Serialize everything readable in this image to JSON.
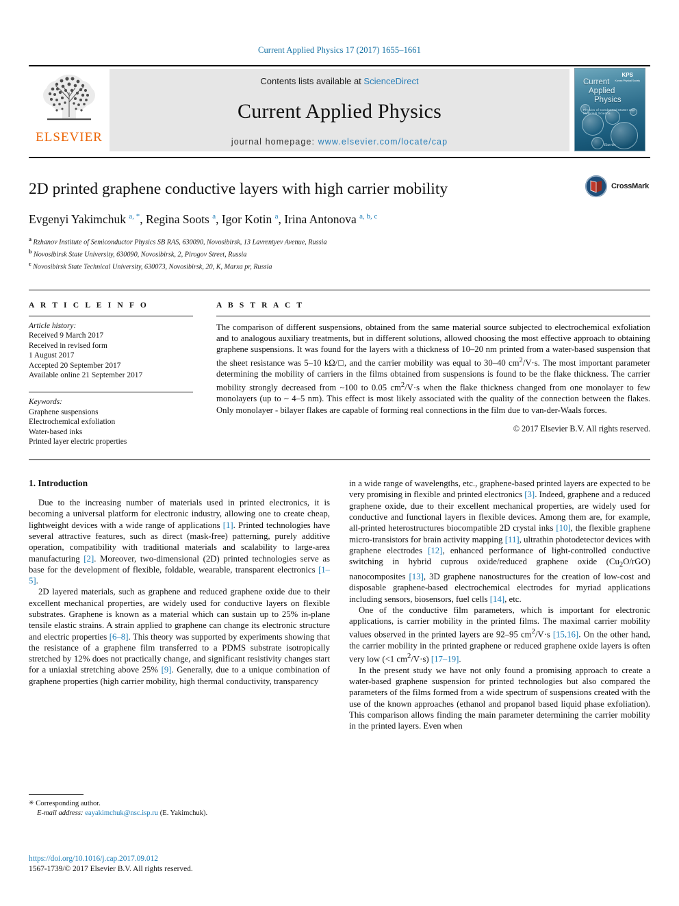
{
  "running_head": "Current Applied Physics 17 (2017) 1655–1661",
  "banner": {
    "publisher_name": "ELSEVIER",
    "contents_prefix": "Contents lists available at ",
    "contents_link": "ScienceDirect",
    "journal_title": "Current Applied Physics",
    "homepage_prefix": "journal homepage: ",
    "homepage_link": "www.elsevier.com/locate/cap",
    "cover": {
      "title_line1": "Current",
      "title_line2": "Applied",
      "title_line3": "Physics",
      "subtitle": "Physics of Condensed Matter and Materials Science",
      "badge": "KPS",
      "badge_sub": "Korean Physical Society",
      "bottom": "Elsevier"
    }
  },
  "crossmark": {
    "label": "CrossMark"
  },
  "article": {
    "title": "2D printed graphene conductive layers with high carrier mobility",
    "authors": [
      {
        "name": "Evgenyi Yakimchuk",
        "marks": "a, *"
      },
      {
        "name": "Regina Soots",
        "marks": "a"
      },
      {
        "name": "Igor Kotin",
        "marks": "a"
      },
      {
        "name": "Irina Antonova",
        "marks": "a, b, c"
      }
    ],
    "affiliations": [
      {
        "mark": "a",
        "text": "Rzhanov Institute of Semiconductor Physics SB RAS, 630090, Novosibirsk, 13 Lavrentyev Avenue, Russia"
      },
      {
        "mark": "b",
        "text": "Novosibirsk State University, 630090, Novosibirsk, 2, Pirogov Street, Russia"
      },
      {
        "mark": "c",
        "text": "Novosibirsk State Technical University, 630073, Novosibirsk, 20, K, Marxa pr, Russia"
      }
    ]
  },
  "article_info": {
    "heading": "A R T I C L E  I N F O",
    "history_label": "Article history:",
    "history": [
      "Received 9 March 2017",
      "Received in revised form",
      "1 August 2017",
      "Accepted 20 September 2017",
      "Available online 21 September 2017"
    ],
    "keywords_label": "Keywords:",
    "keywords": [
      "Graphene suspensions",
      "Electrochemical exfoliation",
      "Water-based inks",
      "Printed layer electric properties"
    ]
  },
  "abstract": {
    "heading": "A B S T R A C T",
    "text": "The comparison of different suspensions, obtained from the same material source subjected to electrochemical exfoliation and to analogous auxiliary treatments, but in different solutions, allowed choosing the most effective approach to obtaining graphene suspensions. It was found for the layers with a thickness of 10–20 nm printed from a water-based suspension that the sheet resistance was 5–10 kΩ/□, and the carrier mobility was equal to 30–40 cm2/V·s. The most important parameter determining the mobility of carriers in the films obtained from suspensions is found to be the flake thickness. The carrier mobility strongly decreased from ~100 to 0.05 cm2/V·s when the flake thickness changed from one monolayer to few monolayers (up to ~ 4–5 nm). This effect is most likely associated with the quality of the connection between the flakes. Only monolayer - bilayer flakes are capable of forming real connections in the film due to van-der-Waals forces.",
    "copyright": "© 2017 Elsevier B.V. All rights reserved."
  },
  "body": {
    "section_title": "1. Introduction",
    "left_paragraphs": [
      "Due to the increasing number of materials used in printed electronics, it is becoming a universal platform for electronic industry, allowing one to create cheap, lightweight devices with a wide range of applications [1]. Printed technologies have several attractive features, such as direct (mask-free) patterning, purely additive operation, compatibility with traditional materials and scalability to large-area manufacturing [2]. Moreover, two-dimensional (2D) printed technologies serve as base for the development of flexible, foldable, wearable, transparent electronics [1–5].",
      "2D layered materials, such as graphene and reduced graphene oxide due to their excellent mechanical properties, are widely used for conductive layers on flexible substrates. Graphene is known as a material which can sustain up to 25% in-plane tensile elastic strains. A strain applied to graphene can change its electronic structure and electric properties [6–8]. This theory was supported by experiments showing that the resistance of a graphene film transferred to a PDMS substrate isotropically stretched by 12% does not practically change, and significant resistivity changes start for a uniaxial stretching above 25% [9]. Generally, due to a unique combination of graphene properties (high carrier mobility, high thermal conductivity, transparency"
    ],
    "right_paragraphs": [
      "in a wide range of wavelengths, etc., graphene-based printed layers are expected to be very promising in flexible and printed electronics [3]. Indeed, graphene and a reduced graphene oxide, due to their excellent mechanical properties, are widely used for conductive and functional layers in flexible devices. Among them are, for example, all-printed heterostructures biocompatible 2D crystal inks [10], the flexible graphene micro-transistors for brain activity mapping [11], ultrathin photodetector devices with graphene electrodes [12], enhanced performance of light-controlled conductive switching in hybrid cuprous oxide/reduced graphene oxide (Cu2O/rGO) nanocomposites [13], 3D graphene nanostructures for the creation of low-cost and disposable graphene-based electrochemical electrodes for myriad applications including sensors, biosensors, fuel cells [14], etc.",
      "One of the conductive film parameters, which is important for electronic applications, is carrier mobility in the printed films. The maximal carrier mobility values observed in the printed layers are 92–95 cm2/V·s [15,16]. On the other hand, the carrier mobility in the printed graphene or reduced graphene oxide layers is often very low (<1 cm2/V·s) [17–19].",
      "In the present study we have not only found a promising approach to create a water-based graphene suspension for printed technologies but also compared the parameters of the films formed from a wide spectrum of suspensions created with the use of the known approaches (ethanol and propanol based liquid phase exfoliation). This comparison allows finding the main parameter determining the carrier mobility in the printed layers. Even when"
    ]
  },
  "footnote": {
    "corresponding": "Corresponding author.",
    "email_label": "E-mail address:",
    "email": "eayakimchuk@nsc.isp.ru",
    "email_suffix": "(E. Yakimchuk)."
  },
  "footer": {
    "doi": "https://doi.org/10.1016/j.cap.2017.09.012",
    "issn": "1567-1739/© 2017 Elsevier B.V. All rights reserved."
  },
  "colors": {
    "link_blue": "#1a7bb5",
    "sd_blue": "#2a7fb8",
    "elsevier_orange": "#ec6607",
    "running_head_blue": "#0b6ba0"
  }
}
